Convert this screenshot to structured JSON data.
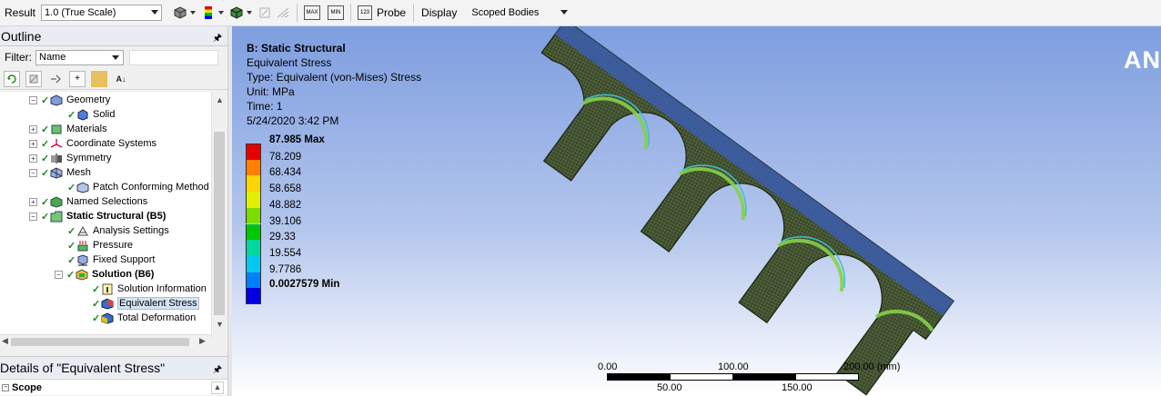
{
  "toolbar": {
    "result_label": "Result",
    "result_value": "1.0 (True Scale)",
    "probe_icon_text": "123",
    "probe_label": "Probe",
    "display_label": "Display",
    "display_value": "Scoped Bodies",
    "max_icon_text": "MAX",
    "min_icon_text": "MIN"
  },
  "outline": {
    "title": "Outline",
    "filter_label": "Filter:",
    "filter_value": "Name",
    "items": [
      {
        "label": "Geometry"
      },
      {
        "label": "Solid"
      },
      {
        "label": "Materials"
      },
      {
        "label": "Coordinate Systems"
      },
      {
        "label": "Symmetry"
      },
      {
        "label": "Mesh"
      },
      {
        "label": "Patch Conforming Method"
      },
      {
        "label": "Named Selections"
      },
      {
        "label": "Static Structural (B5)"
      },
      {
        "label": "Analysis Settings"
      },
      {
        "label": "Pressure"
      },
      {
        "label": "Fixed Support"
      },
      {
        "label": "Solution (B6)"
      },
      {
        "label": "Solution Information"
      },
      {
        "label": "Equivalent Stress"
      },
      {
        "label": "Total Deformation"
      }
    ]
  },
  "details": {
    "title": "Details of \"Equivalent Stress\"",
    "scope_label": "Scope"
  },
  "viewport": {
    "title": "B: Static Structural",
    "result_name": "Equivalent Stress",
    "type": "Type: Equivalent (von-Mises) Stress",
    "unit": "Unit: MPa",
    "time": "Time: 1",
    "date": "5/24/2020 3:42 PM",
    "logo": "AN",
    "legend": [
      {
        "label": "87.985 Max",
        "color": "#e60000"
      },
      {
        "label": "78.209",
        "color": "#ff7f00"
      },
      {
        "label": "68.434",
        "color": "#ffd400"
      },
      {
        "label": "58.658",
        "color": "#e0f000"
      },
      {
        "label": "48.882",
        "color": "#7cdc00"
      },
      {
        "label": "39.106",
        "color": "#00c800"
      },
      {
        "label": "29.33",
        "color": "#00d6a0"
      },
      {
        "label": "19.554",
        "color": "#00c8f0"
      },
      {
        "label": "9.7786",
        "color": "#0080ff"
      },
      {
        "label": "0.0027579 Min",
        "color": "#0000e0"
      }
    ],
    "scale": {
      "top": [
        "0.00",
        "100.00",
        "200.00 (mm)"
      ],
      "bottom": [
        "50.00",
        "150.00"
      ]
    }
  }
}
